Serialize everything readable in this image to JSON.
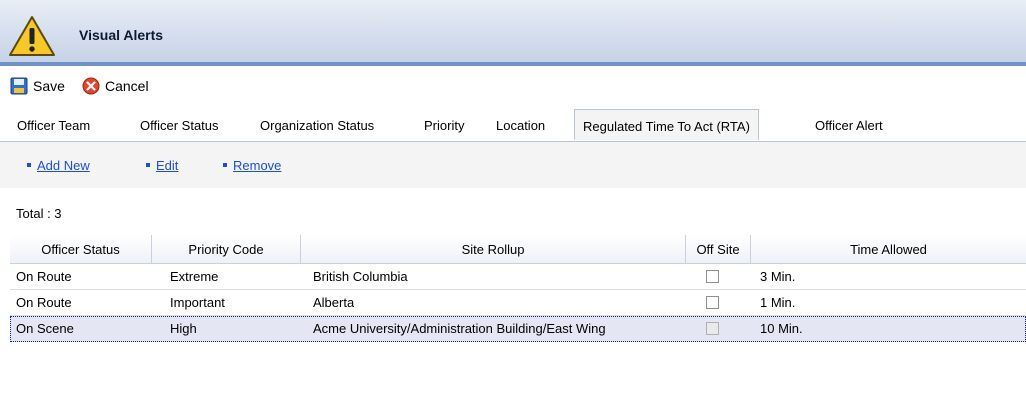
{
  "window": {
    "title": "Visual Alerts",
    "icon": "warning-icon"
  },
  "toolbar": {
    "save_label": "Save",
    "save_icon": "save-icon",
    "cancel_label": "Cancel",
    "cancel_icon": "cancel-icon"
  },
  "tabs": [
    {
      "label": "Officer Team"
    },
    {
      "label": "Officer Status"
    },
    {
      "label": "Organization Status"
    },
    {
      "label": "Priority"
    },
    {
      "label": "Location"
    },
    {
      "label": "Regulated Time To Act (RTA)",
      "active": true
    },
    {
      "label": "Officer Alert"
    }
  ],
  "actions": {
    "add_new": "Add New",
    "edit": "Edit",
    "remove": "Remove"
  },
  "total_label": "Total : 3",
  "grid": {
    "columns": [
      "Officer Status",
      "Priority Code",
      "Site Rollup",
      "Off Site",
      "Time Allowed"
    ],
    "rows": [
      {
        "officer_status": "On Route",
        "priority_code": "Extreme",
        "site_rollup": "British Columbia",
        "off_site": false,
        "time_allowed": "3 Min."
      },
      {
        "officer_status": "On Route",
        "priority_code": "Important",
        "site_rollup": "Alberta",
        "off_site": false,
        "time_allowed": "1 Min."
      },
      {
        "officer_status": "On Scene",
        "priority_code": "High",
        "site_rollup": "Acme University/Administration Building/East Wing",
        "off_site": false,
        "time_allowed": "10 Min.",
        "selected": true
      }
    ]
  },
  "colors": {
    "accent": "#6f93c8",
    "link": "#1c4fd8",
    "selection": "#e4e6f3"
  }
}
